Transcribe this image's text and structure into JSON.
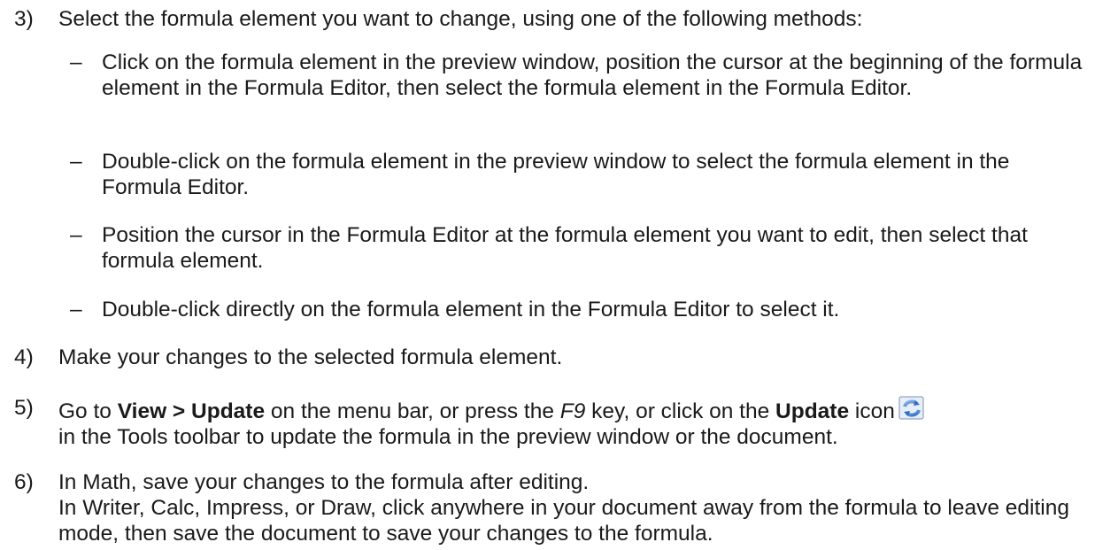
{
  "steps": [
    {
      "number": "3)",
      "text": "Select the formula element you want to change, using one of the following methods:",
      "subitems": [
        {
          "bullet": "–",
          "text": "Click on the formula element in the preview window, position the cursor at the beginning of the formula element in the Formula Editor, then select the formula element in the Formula Editor."
        },
        {
          "bullet": "–",
          "text": "Double-click on the formula element in the preview window to select the formula element in the Formula Editor."
        },
        {
          "bullet": "–",
          "text": "Position the cursor in the Formula Editor at the formula element you want to edit, then select that formula element."
        },
        {
          "bullet": "–",
          "text": "Double-click directly on the formula element in the Formula Editor to select it."
        }
      ]
    },
    {
      "number": "4)",
      "text": "Make your changes to the selected formula element."
    },
    {
      "number": "5)",
      "text_parts": {
        "p1": "Go to ",
        "menu_path": "View > Update",
        "p2": " on the menu bar, or press the ",
        "key": "F9",
        "p3": " key, or click on the ",
        "icon_name": "Update",
        "p4": " icon",
        "p5": " in the Tools toolbar to update the formula in the preview window or the document."
      },
      "icon": "update-icon"
    },
    {
      "number": "6)",
      "line1": "In Math, save your changes to the formula after editing.",
      "line2": "In Writer, Calc, Impress, or Draw, click anywhere in your document away from the formula to leave editing mode, then save the document to save your changes to the formula."
    }
  ]
}
